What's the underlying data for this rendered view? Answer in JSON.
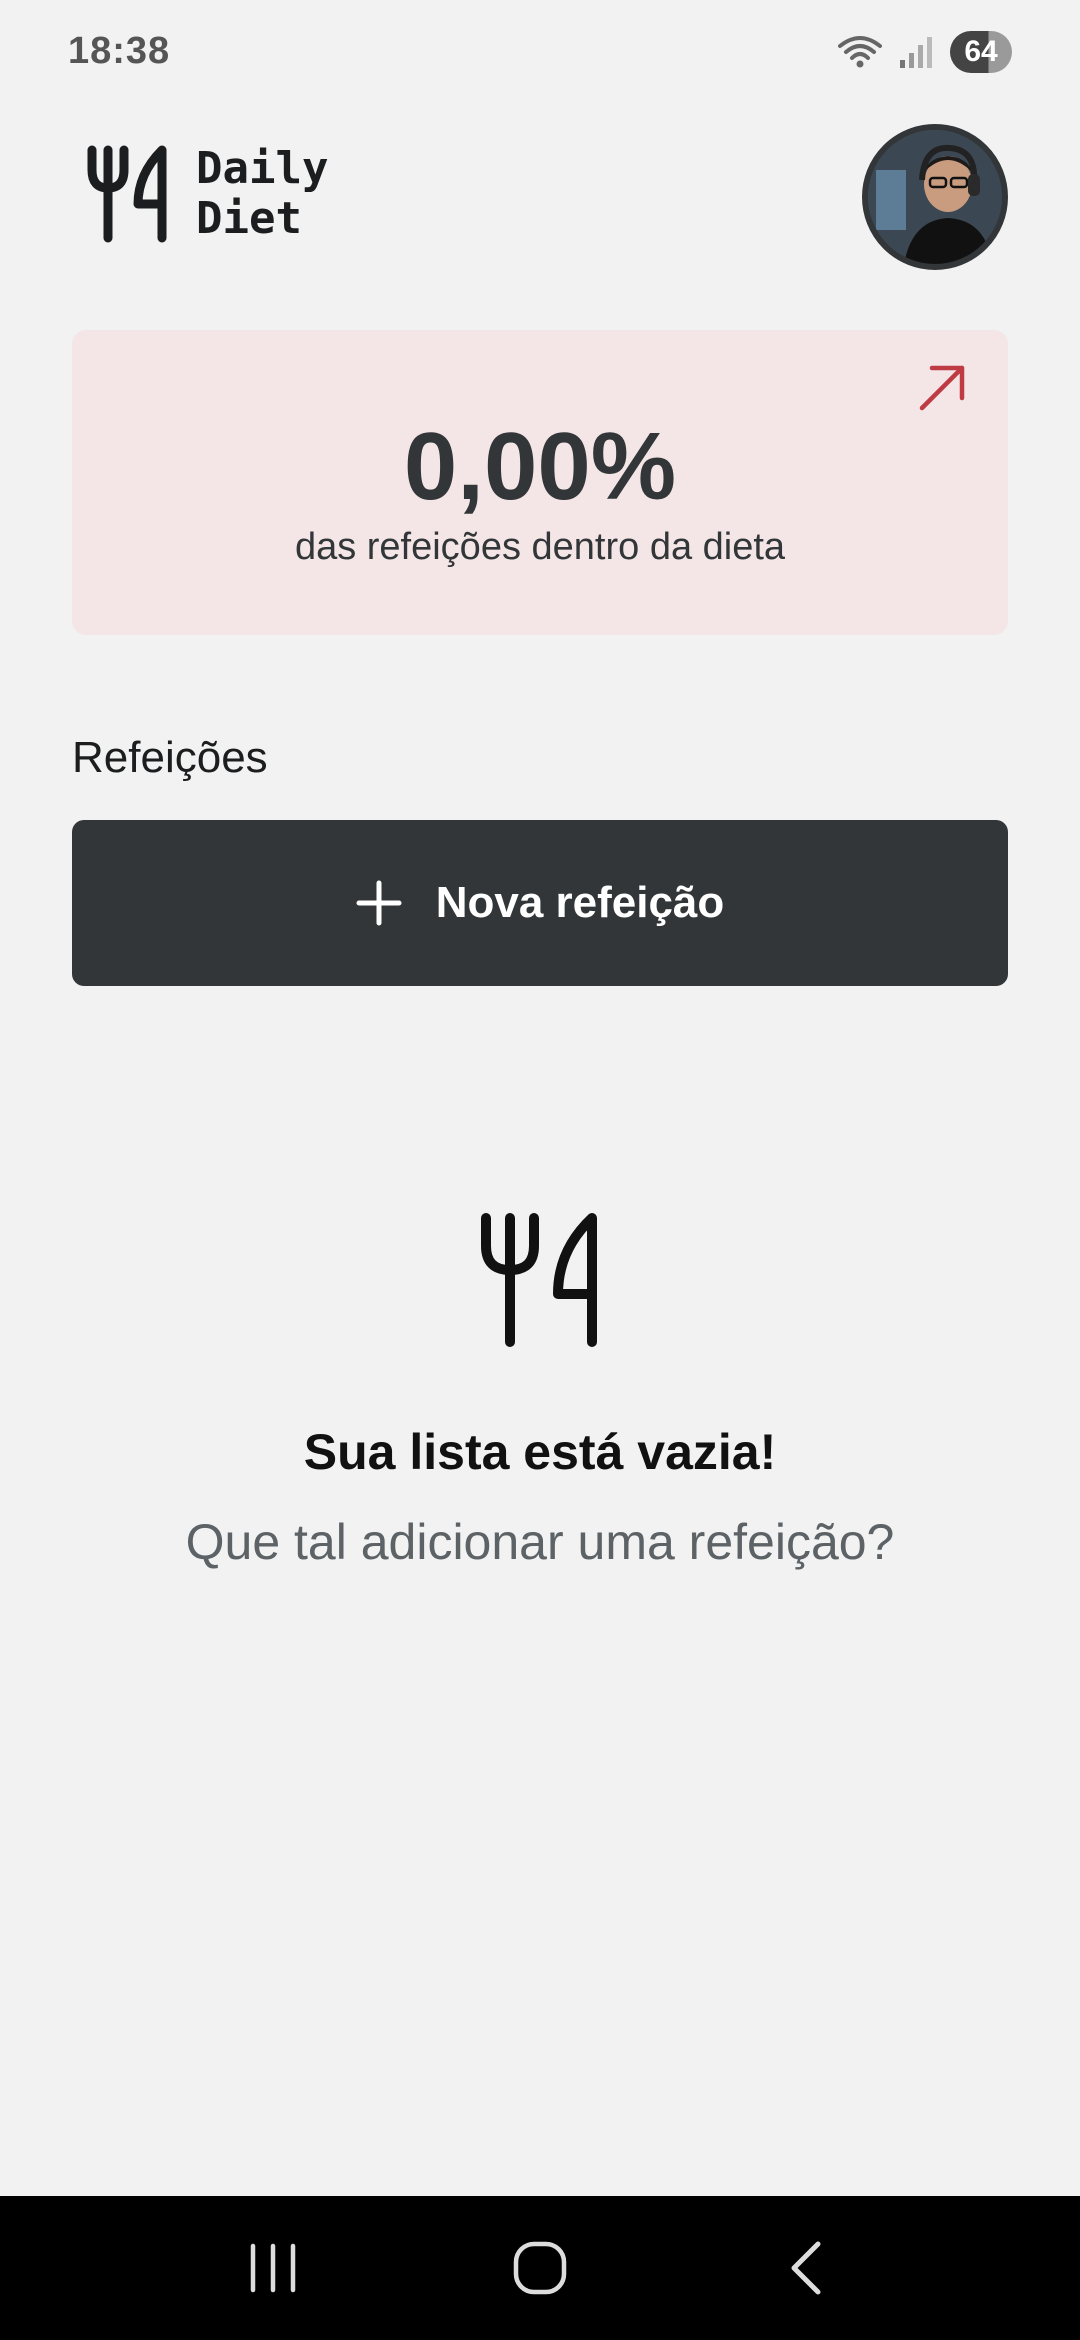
{
  "status_bar": {
    "time": "18:38",
    "battery": "64",
    "icons": [
      "wifi-icon",
      "signal-icon",
      "battery-icon"
    ]
  },
  "header": {
    "logo_line1": "Daily",
    "logo_line2": "Diet",
    "logo_icon": "fork-knife-icon",
    "avatar": "user-avatar"
  },
  "stats": {
    "value": "0,00%",
    "label": "das refeições dentro da dieta",
    "arrow_icon": "arrow-up-right-icon",
    "accent_color": "#BF3B44",
    "background_color": "#F4E6E7"
  },
  "meals": {
    "section_title": "Refeições",
    "new_meal_label": "Nova refeição",
    "button_icon": "plus-icon",
    "button_color": "#333638"
  },
  "empty_state": {
    "icon": "fork-knife-icon",
    "title": "Sua lista está vazia!",
    "subtitle": "Que tal adicionar uma refeição?"
  },
  "nav_bar": {
    "buttons": [
      "recent-apps-icon",
      "home-icon",
      "back-icon"
    ]
  }
}
